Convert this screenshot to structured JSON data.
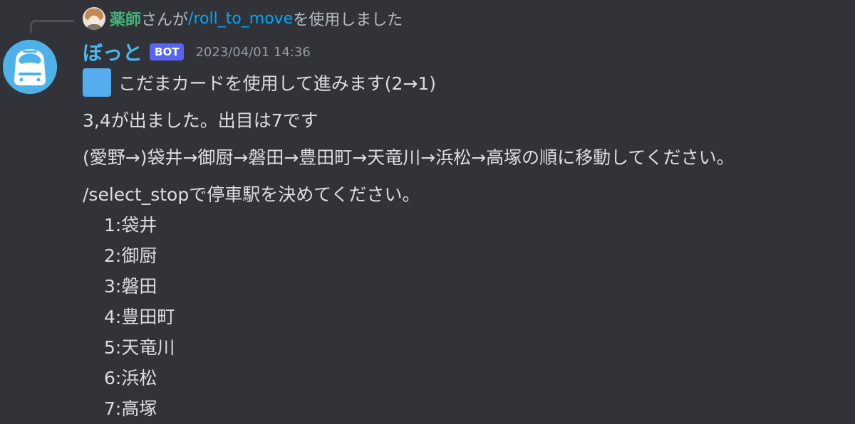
{
  "reply": {
    "user": "薬師",
    "text_before": "さんが",
    "command": "/roll_to_move",
    "text_after": "を使用しました"
  },
  "author": {
    "name": "ぼっと",
    "tag": "BOT",
    "timestamp": "2023/04/01 14:36"
  },
  "message": {
    "line1": "こだまカードを使用して進みます(2→1)",
    "line2": "3,4が出ました。出目は7です",
    "line3": "(愛野→)袋井→御厨→磐田→豊田町→天竜川→浜松→高塚の順に移動してください。",
    "line4": "/select_stopで停車駅を決めてください。",
    "options": [
      "1:袋井",
      "2:御厨",
      "3:磐田",
      "4:豊田町",
      "5:天竜川",
      "6:浜松",
      "7:高塚"
    ]
  },
  "icons": {
    "card_emoji": "blue-square-icon",
    "bot_avatar": "train-avatar",
    "user_avatar": "user-avatar"
  },
  "colors": {
    "background": "#313338",
    "username": "#4ab8f0",
    "reply_user": "#45b37c",
    "command": "#00a8fc",
    "bot_tag": "#5865f2"
  }
}
